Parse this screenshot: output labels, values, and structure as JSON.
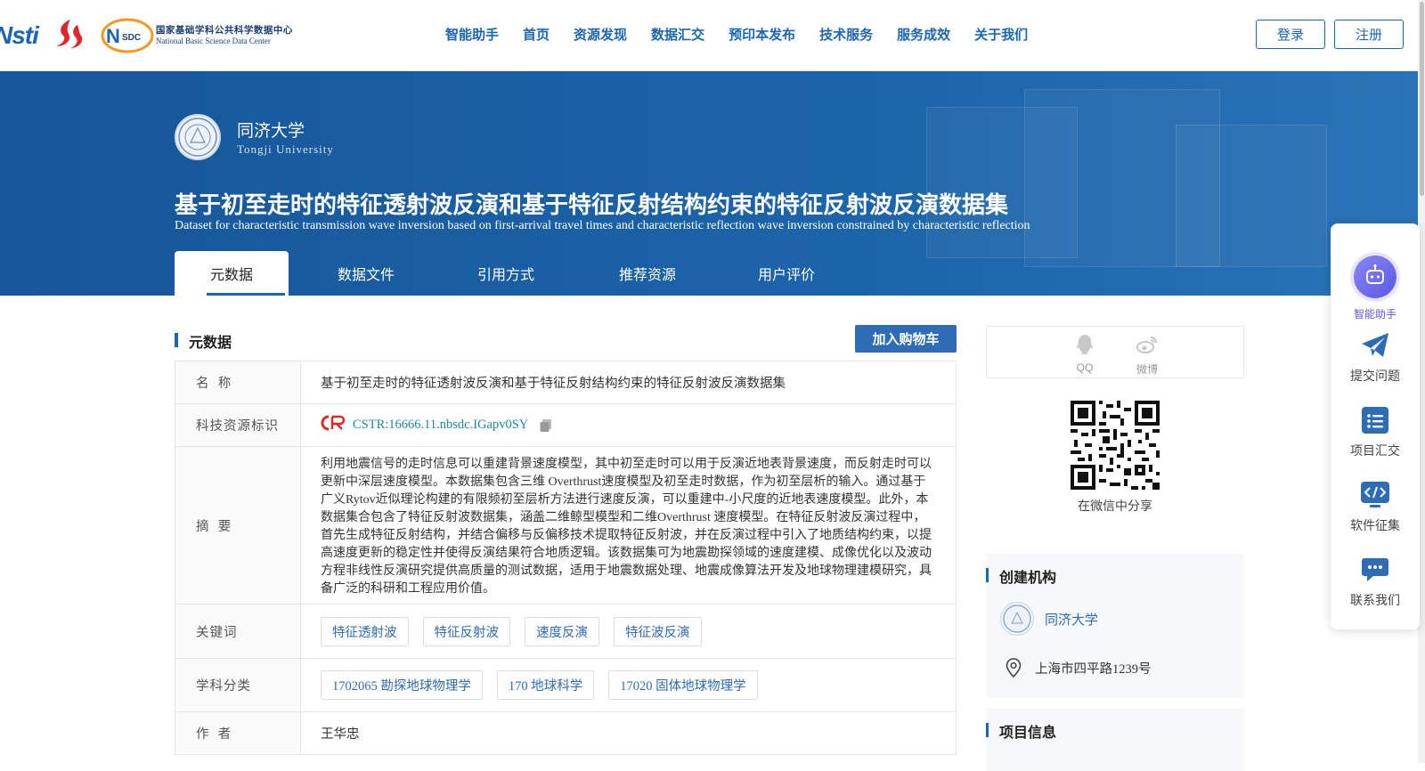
{
  "header": {
    "logo_left_text": "Nsti",
    "logo_nsdc_mark": "NSDC",
    "logo_nsdc_cn": "国家基础学科公共科学数据中心",
    "logo_nsdc_en": "National Basic Science Data Center",
    "nav": [
      "智能助手",
      "首页",
      "资源发现",
      "数据汇交",
      "预印本发布",
      "技术服务",
      "服务成效",
      "关于我们"
    ],
    "login_label": "登录",
    "register_label": "注册"
  },
  "hero": {
    "org_name": "同济大学",
    "org_en": "Tongji University",
    "title": "基于初至走时的特征透射波反演和基于特征反射结构约束的特征反射波反演数据集",
    "title_en": "Dataset for characteristic transmission wave inversion based on first-arrival travel times and characteristic reflection wave inversion constrained by characteristic reflection",
    "tabs": [
      "元数据",
      "数据文件",
      "引用方式",
      "推荐资源",
      "用户评价"
    ],
    "active_tab": "元数据"
  },
  "metadata": {
    "section_title": "元数据",
    "cart_label": "加入购物车",
    "name_label": "名  称",
    "name_value": "基于初至走时的特征透射波反演和基于特征反射结构约束的特征反射波反演数据集",
    "id_label": "科技资源标识",
    "cstr_value": "CSTR:16666.11.nbsdc.IGapv0SY",
    "abstract_label": "摘  要",
    "abstract_value": "利用地震信号的走时信息可以重建背景速度模型，其中初至走时可以用于反演近地表背景速度，而反射走时可以更新中深层速度模型。本数据集包含三维 Overthrust速度模型及初至走时数据，作为初至层析的输入。通过基于广义Rytov近似理论构建的有限频初至层析方法进行速度反演，可以重建中-小尺度的近地表速度模型。此外，本数据集合包含了特征反射波数据集，涵盖二维鲸型模型和二维Overthrust 速度模型。在特征反射波反演过程中，首先生成特征反射结构，并结合偏移与反偏移技术提取特征反射波，并在反演过程中引入了地质结构约束，以提高速度更新的稳定性并使得反演结果符合地质逻辑。该数据集可为地震勘探领域的速度建模、成像优化以及波动方程非线性反演研究提供高质量的测试数据，适用于地震数据处理、地震成像算法开发及地球物理建模研究，具备广泛的科研和工程应用价值。",
    "keywords_label": "关键词",
    "keywords": [
      "特征透射波",
      "特征反射波",
      "速度反演",
      "特征波反演"
    ],
    "subject_label": "学科分类",
    "subjects": [
      "1702065 勘探地球物理学",
      "170 地球科学",
      "17020 固体地球物理学"
    ],
    "author_label": "作  者",
    "author_value": "王华忠"
  },
  "sidebar": {
    "share_qq": "QQ",
    "share_weibo": "微博",
    "qr_caption": "在微信中分享",
    "org_box_title": "创建机构",
    "org_name": "同济大学",
    "org_address": "上海市四平路1239号",
    "project_box_title": "项目信息"
  },
  "float_menu": {
    "items": [
      "智能助手",
      "提交问题",
      "项目汇交",
      "软件征集",
      "联系我们"
    ]
  },
  "colors": {
    "brand_blue": "#1b66b3",
    "hero_blue": "#1c64a8",
    "cart_blue": "#2e6cb5",
    "assistant_purple": "#6f6cf0"
  }
}
